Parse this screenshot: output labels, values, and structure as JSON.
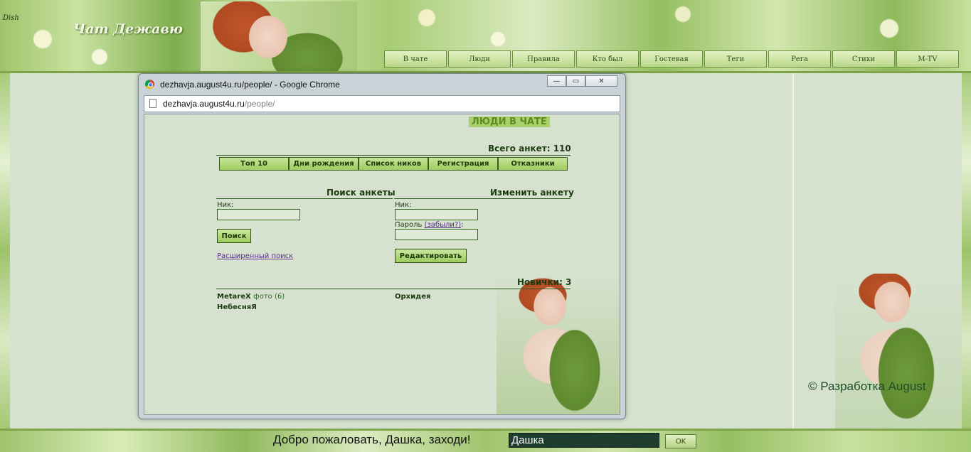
{
  "header": {
    "corner_text": "Dish",
    "logo": "Чат Дежавю",
    "nav": [
      "В чате",
      "Люди",
      "Правила",
      "Кто был",
      "Гостевая",
      "Теги",
      "Рега",
      "Стихи",
      "M-TV"
    ]
  },
  "browser": {
    "window_title": "dezhavja.august4u.ru/people/ - Google Chrome",
    "address_host": "dezhavja.august4u.ru",
    "address_path": "/people/",
    "controls": [
      "minimize",
      "maximize",
      "close"
    ]
  },
  "people": {
    "title": "ЛЮДИ В ЧАТЕ",
    "total_label": "Всего анкет: 110",
    "tabs": [
      "Топ 10",
      "Дни рождения",
      "Список ников",
      "Регистрация",
      "Отказники"
    ],
    "search": {
      "heading": "Поиск анкеты",
      "nick_label": "Ник:",
      "button": "Поиск",
      "advanced_link": "Расширенный поиск"
    },
    "edit": {
      "heading": "Изменить анкету",
      "nick_label": "Ник:",
      "password_label": "Пароль",
      "forgot_link": "(забыли?)",
      "password_suffix": ":",
      "button": "Редактировать"
    },
    "newbies": {
      "heading": "Новички: 3",
      "items": [
        {
          "nick": "MetareX",
          "photo": "фото (6)"
        },
        {
          "nick": "Орхидея"
        },
        {
          "nick": "НебесняЯ"
        }
      ]
    }
  },
  "sidebar": {
    "copyright": "© Разработка August"
  },
  "footer": {
    "welcome": "Добро пожаловать, Дашка, заходи!",
    "name_value": "Дашка",
    "ok_button": "OK"
  },
  "colors": {
    "background": "#d6e2cf",
    "accent_green": "#9fcc5e",
    "text_dark_green": "#1d3b12"
  }
}
